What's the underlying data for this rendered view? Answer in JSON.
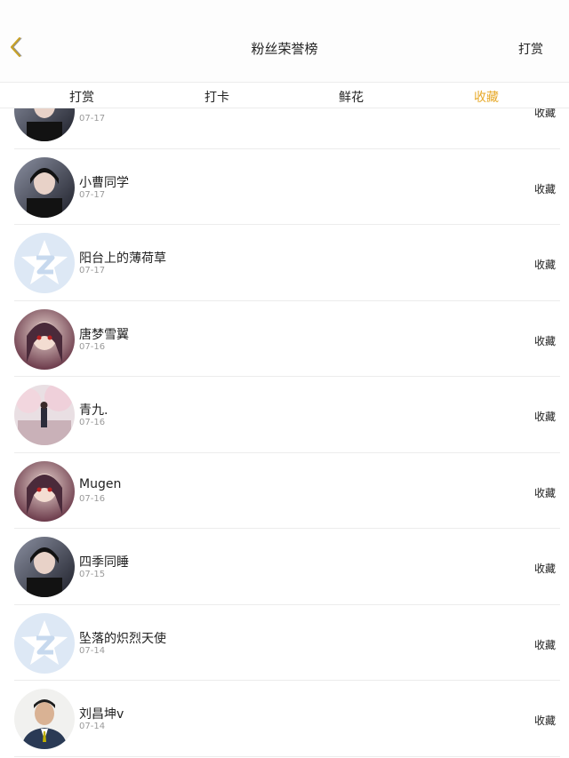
{
  "header": {
    "title": "粉丝荣誉榜",
    "reward_label": "打赏",
    "back_icon": "chevron-left-icon",
    "accent_color": "#e7aa2b"
  },
  "tabs": [
    {
      "label": "打赏",
      "active": false
    },
    {
      "label": "打卡",
      "active": false
    },
    {
      "label": "鲜花",
      "active": false
    },
    {
      "label": "收藏",
      "active": true
    }
  ],
  "list": [
    {
      "name": "",
      "date": "07-17",
      "action": "收藏",
      "avatar": "photo-avatar"
    },
    {
      "name": "小曹同学",
      "date": "07-17",
      "action": "收藏",
      "avatar": "photo-avatar"
    },
    {
      "name": "阳台上的薄荷草",
      "date": "07-17",
      "action": "收藏",
      "avatar": "default-qzone-avatar"
    },
    {
      "name": "唐梦雪翼",
      "date": "07-16",
      "action": "收藏",
      "avatar": "anime-avatar"
    },
    {
      "name": "青九.",
      "date": "07-16",
      "action": "收藏",
      "avatar": "blossom-avatar"
    },
    {
      "name": "Mugen",
      "date": "07-16",
      "action": "收藏",
      "avatar": "anime-avatar"
    },
    {
      "name": "四季同睡",
      "date": "07-15",
      "action": "收藏",
      "avatar": "photo-avatar"
    },
    {
      "name": "坠落的炽烈天使",
      "date": "07-14",
      "action": "收藏",
      "avatar": "default-qzone-avatar"
    },
    {
      "name": "刘昌坤v",
      "date": "07-14",
      "action": "收藏",
      "avatar": "person-avatar"
    }
  ]
}
